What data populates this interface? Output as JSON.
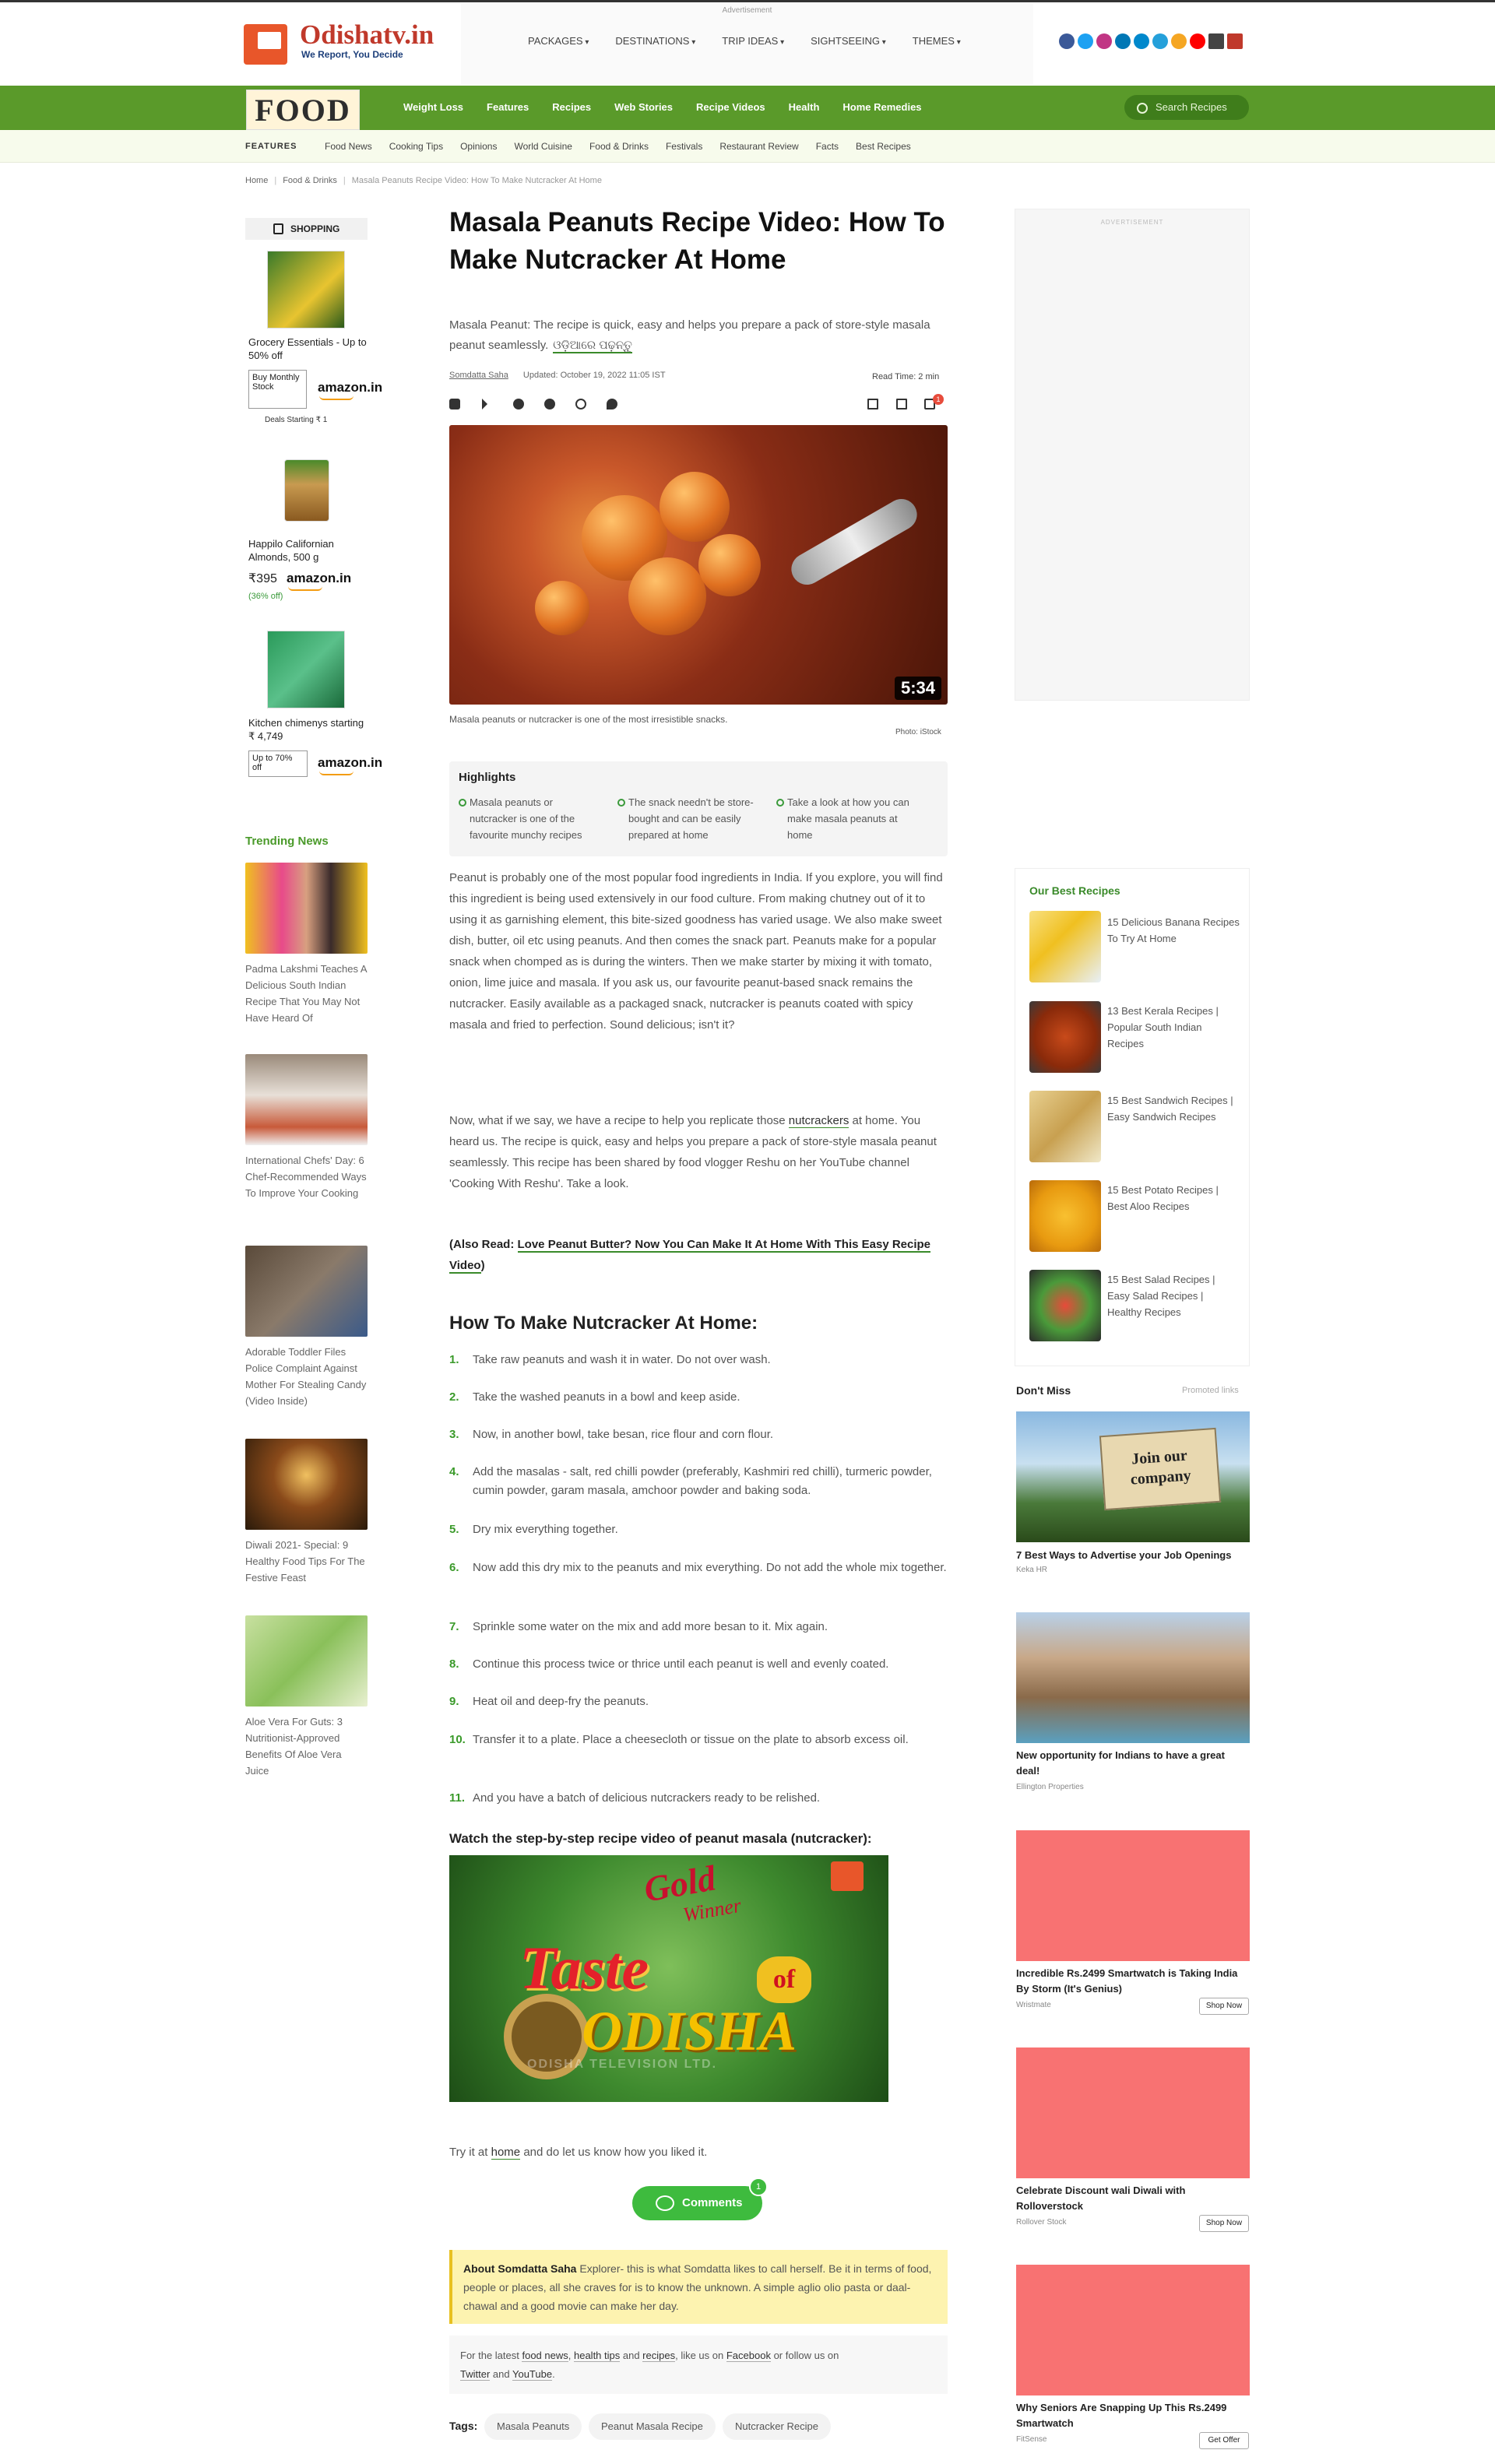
{
  "header": {
    "brand": "Odishatv.in",
    "tagline": "We Report, You Decide",
    "ad_label": "Advertisement",
    "nav": [
      "PACKAGES",
      "DESTINATIONS",
      "TRIP IDEAS",
      "SIGHTSEEING",
      "THEMES"
    ],
    "social_colors": [
      "#3b5998",
      "#1da1f2",
      "#c13584",
      "#0077b5",
      "#0088cc",
      "#25a0da",
      "#f5a623",
      "#ff0000",
      "#444444",
      "#c0392b"
    ]
  },
  "food_nav": {
    "logo": "FOOD",
    "items": [
      "Weight Loss",
      "Features",
      "Recipes",
      "Web Stories",
      "Recipe Videos",
      "Health",
      "Home Remedies"
    ],
    "search_placeholder": "Search Recipes"
  },
  "sub_nav": {
    "label": "FEATURES",
    "items": [
      "Food News",
      "Cooking Tips",
      "Opinions",
      "World Cuisine",
      "Food & Drinks",
      "Festivals",
      "Restaurant Review",
      "Facts",
      "Best Recipes"
    ]
  },
  "breadcrumb": [
    "Home",
    "Food & Drinks",
    "Masala Peanuts Recipe Video: How To Make Nutcracker At Home"
  ],
  "shopping": {
    "title": "SHOPPING",
    "products": [
      {
        "name": "Grocery Essentials - Up to 50% off",
        "badge": "Buy Monthly Stock",
        "store": "amazon.in",
        "note": "Deals Starting ₹ 1"
      },
      {
        "name": "Happilo Californian Almonds, 500 g",
        "price": "₹395",
        "discount": "(36% off)",
        "store": "amazon.in"
      },
      {
        "name": "Kitchen chimenys starting ₹ 4,749",
        "badge": "Up to 70% off",
        "store": "amazon.in"
      }
    ]
  },
  "trending": {
    "title": "Trending News",
    "items": [
      "Padma Lakshmi Teaches A Delicious South Indian Recipe That You May Not Have Heard Of",
      "International Chefs' Day: 6 Chef-Recommended Ways To Improve Your Cooking",
      "Adorable Toddler Files Police Complaint Against Mother For Stealing Candy (Video Inside)",
      "Diwali 2021- Special: 9 Healthy Food Tips For The Festive Feast",
      "Aloe Vera For Guts: 3 Nutritionist-Approved Benefits Of Aloe Vera Juice"
    ]
  },
  "article": {
    "title": "Masala Peanuts Recipe Video: How To Make Nutcracker At Home",
    "summary": "Masala Peanut: The recipe is quick, easy and helps you prepare a pack of store-style masala peanut seamlessly.",
    "summary_odia": "ଓଡ଼ିଆରେ ପଢ଼ନ୍ତୁ",
    "author": "Somdatta Saha",
    "updated": "Updated: October 19, 2022 11:05 IST",
    "read_time": "Read Time: 2 min",
    "comment_count": "1",
    "video_duration": "5:34",
    "caption": "Masala peanuts or nutcracker is one of the most irresistible snacks.",
    "photo_credit": "Photo: iStock",
    "highlights_title": "Highlights",
    "highlights": [
      "Masala peanuts or nutcracker is one of the favourite munchy recipes",
      "The snack needn't be store-bought and can be easily prepared at home",
      "Take a look at how you can make masala peanuts at home"
    ],
    "para1": "Peanut is probably one of the most popular food ingredients in India. If you explore, you will find this ingredient is being used extensively in our food culture. From making chutney out of it to using it as garnishing element, this bite-sized goodness has varied usage. We also make sweet dish, butter, oil etc using peanuts. And then comes the snack part. Peanuts make for a popular snack when chomped as is during the winters. Then we make starter by mixing it with tomato, onion, lime juice and masala. If you ask us, our favourite peanut-based snack remains the nutcracker. Easily available as a packaged snack, nutcracker is peanuts coated with spicy masala and fried to perfection. Sound delicious; isn't it?",
    "para2_a": "Now, what if we say, we have a recipe to help you replicate those ",
    "para2_link": "nutcrackers",
    "para2_b": " at home. You heard us. The recipe is quick, easy and helps you prepare a pack of store-style masala peanut seamlessly. This recipe has been shared by food vlogger Reshu on her YouTube channel 'Cooking With Reshu'. Take a look.",
    "also_read_prefix": "(Also Read: ",
    "also_read_link": "Love Peanut Butter? Now You Can Make It At Home With This Easy Recipe Video",
    "also_read_suffix": ")",
    "howto_title": "How To Make Nutcracker At Home:",
    "steps": [
      "Take raw peanuts and wash it in water. Do not over wash.",
      "Take the washed peanuts in a bowl and keep aside.",
      "Now, in another bowl, take besan, rice flour and corn flour.",
      "Add the masalas - salt, red chilli powder (preferably, Kashmiri red chilli), turmeric powder, cumin powder, garam masala, amchoor powder and baking soda.",
      "Dry mix everything together.",
      "Now add this dry mix to the peanuts and mix everything. Do not add the whole mix together.",
      "Sprinkle some water on the mix and add more besan to it. Mix again.",
      "Continue this process twice or thrice until each peanut is well and evenly coated.",
      "Heat oil and deep-fry the peanuts.",
      "Transfer it to a plate. Place a cheesecloth or tissue on the plate to absorb excess oil.",
      "And you have a batch of delicious nutcrackers ready to be relished."
    ],
    "watch_title": "Watch the step-by-step recipe video of peanut masala (nutcracker):",
    "video_title_gold": "Gold",
    "video_title_winner": "Winner",
    "video_title_taste": "Taste",
    "video_title_of": "of",
    "video_title_odisha": "ODISHA",
    "video_footer": "ODISHA TELEVISION LTD.",
    "try_prefix": "Try it at ",
    "try_link": "home",
    "try_suffix": " and do let us know how you liked it.",
    "comments_label": "Comments",
    "about_label": "About Somdatta Saha",
    "about_text": "Explorer- this is what Somdatta likes to call herself. Be it in terms of food, people or places, all she craves for is to know the unknown. A simple aglio olio pasta or daal-chawal and a good movie can make her day.",
    "follow_a": "For the latest ",
    "follow_food": "food news",
    "follow_b": ", ",
    "follow_health": "health tips",
    "follow_c": " and ",
    "follow_recipes": "recipes",
    "follow_d": ", like us on ",
    "follow_fb": "Facebook",
    "follow_e": " or follow us on ",
    "follow_tw": "Twitter",
    "follow_f": " and ",
    "follow_yt": "YouTube",
    "follow_g": ".",
    "tags_label": "Tags:",
    "tags": [
      "Masala Peanuts",
      "Peanut Masala Recipe",
      "Nutcracker Recipe"
    ]
  },
  "right": {
    "ad_label": "ADVERTISEMENT",
    "best_title": "Our Best Recipes",
    "best": [
      "15 Delicious Banana Recipes To Try At Home",
      "13 Best Kerala Recipes | Popular South Indian Recipes",
      "15 Best Sandwich Recipes | Easy Sandwich Recipes",
      "15 Best Potato Recipes | Best Aloo Recipes",
      "15 Best Salad Recipes | Easy Salad Recipes | Healthy Recipes"
    ],
    "dont_miss_title": "Don't Miss",
    "promoted": "Promoted links",
    "dont_miss": [
      {
        "title": "7 Best Ways to Advertise your Job Openings",
        "source": "Keka HR",
        "sign": "Join our company"
      },
      {
        "title": "New opportunity for Indians to have a great deal!",
        "source": "Ellington Properties"
      },
      {
        "title": "Incredible Rs.2499 Smartwatch is Taking India By Storm (It's Genius)",
        "source": "Wristmate",
        "button": "Shop Now"
      },
      {
        "title": "Celebrate Discount wali Diwali with Rolloverstock",
        "source": "Rollover Stock",
        "button": "Shop Now"
      },
      {
        "title": "Why Seniors Are Snapping Up This Rs.2499 Smartwatch",
        "source": "FitSense",
        "button": "Get Offer"
      }
    ]
  }
}
